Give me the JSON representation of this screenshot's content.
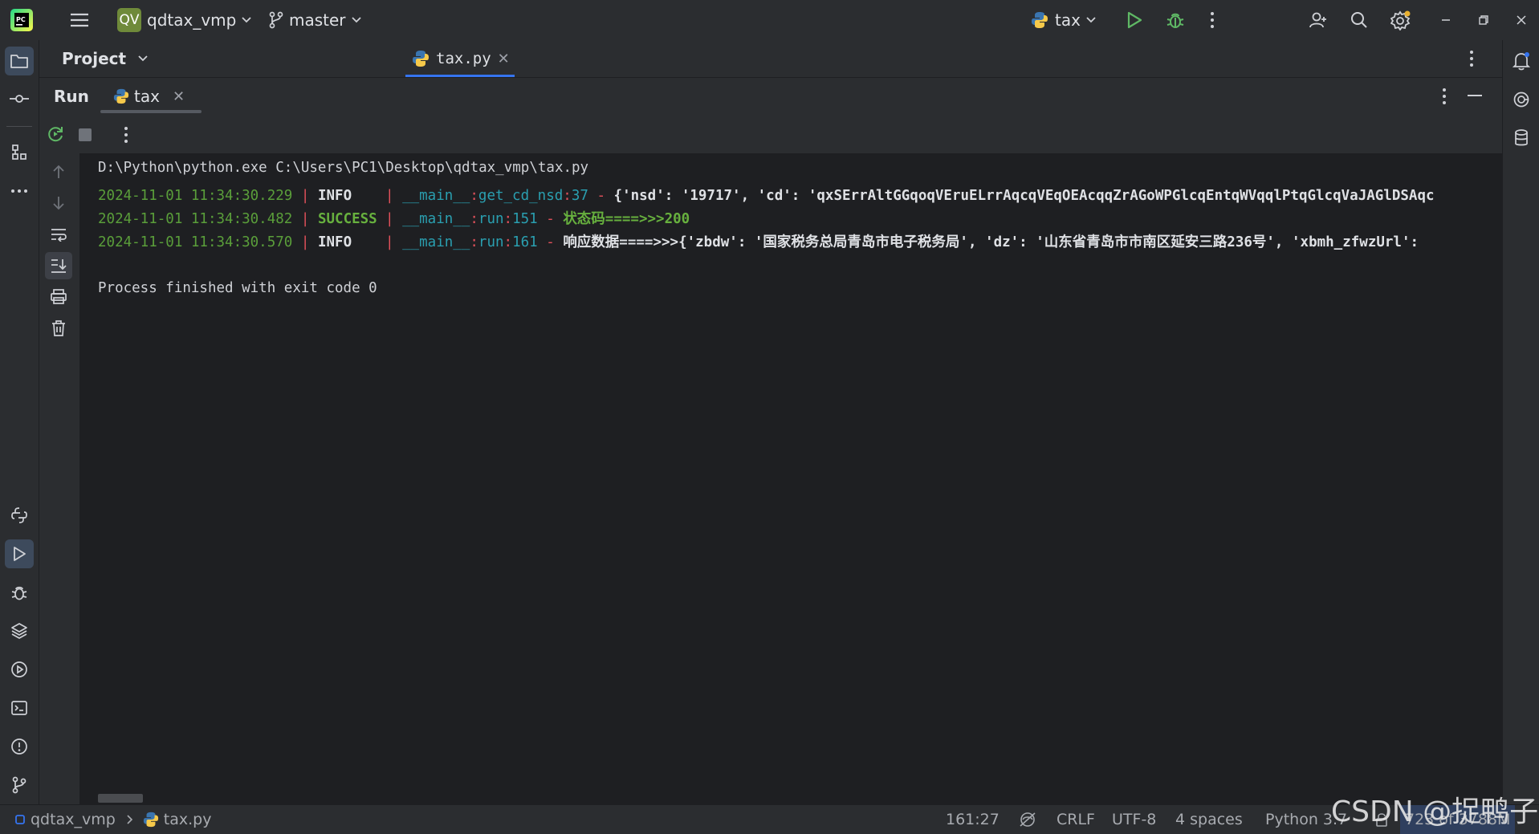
{
  "titlebar": {
    "project_badge": "QV",
    "project_name": "qdtax_vmp",
    "branch": "master",
    "run_config": "tax",
    "icons": [
      "pycharm-logo-icon",
      "hamburger-menu-icon",
      "branch-icon",
      "python-icon",
      "run-icon",
      "debug-icon",
      "more-vertical-icon",
      "add-user-icon",
      "search-icon",
      "settings-icon",
      "minimize-icon",
      "restore-icon",
      "close-icon"
    ]
  },
  "tabs": {
    "project_panel_title": "Project",
    "editor_tab": "tax.py"
  },
  "run_panel": {
    "title": "Run",
    "tab": "tax"
  },
  "console": {
    "command": "D:\\Python\\python.exe C:\\Users\\PC1\\Desktop\\qdtax_vmp\\tax.py",
    "logs": [
      {
        "time": "2024-11-01 11:34:30.229",
        "level": "INFO",
        "sep": "|",
        "module": "__main__",
        "func": "get_cd_nsd",
        "line": "37",
        "dash": "-",
        "message": "{'nsd': '19717', 'cd': 'qxSErrAltGGqoqVEruELrrAqcqVEqOEAcqqZrAGoWPGlcqEntqWVqqlPtqGlcqVaJAGlDSAqc"
      },
      {
        "time": "2024-11-01 11:34:30.482",
        "level": "SUCCESS",
        "sep": "|",
        "module": "__main__",
        "func": "run",
        "line": "151",
        "dash": "-",
        "message": "状态码====>>>200"
      },
      {
        "time": "2024-11-01 11:34:30.570",
        "level": "INFO",
        "sep": "|",
        "module": "__main__",
        "func": "run",
        "line": "161",
        "dash": "-",
        "message": "响应数据====>>>{'zbdw': '国家税务总局青岛市电子税务局', 'dz': '山东省青岛市市南区延安三路236号', 'xbmh_zfwzUrl':"
      }
    ],
    "exit_message": "Process finished with exit code 0"
  },
  "statusbar": {
    "breadcrumb_project": "qdtax_vmp",
    "breadcrumb_file": "tax.py",
    "position": "161:27",
    "line_ending": "CRLF",
    "encoding": "UTF-8",
    "indent": "4 spaces",
    "interpreter": "Python 3.7",
    "memory": "723 of 3788M"
  },
  "watermark": "CSDN @捉鸭子",
  "colors": {
    "accent": "#3574f0",
    "log_time": "#5a9e3a",
    "log_sep": "#e0505a",
    "log_module": "#2a9fb0",
    "success": "#67b03e"
  }
}
